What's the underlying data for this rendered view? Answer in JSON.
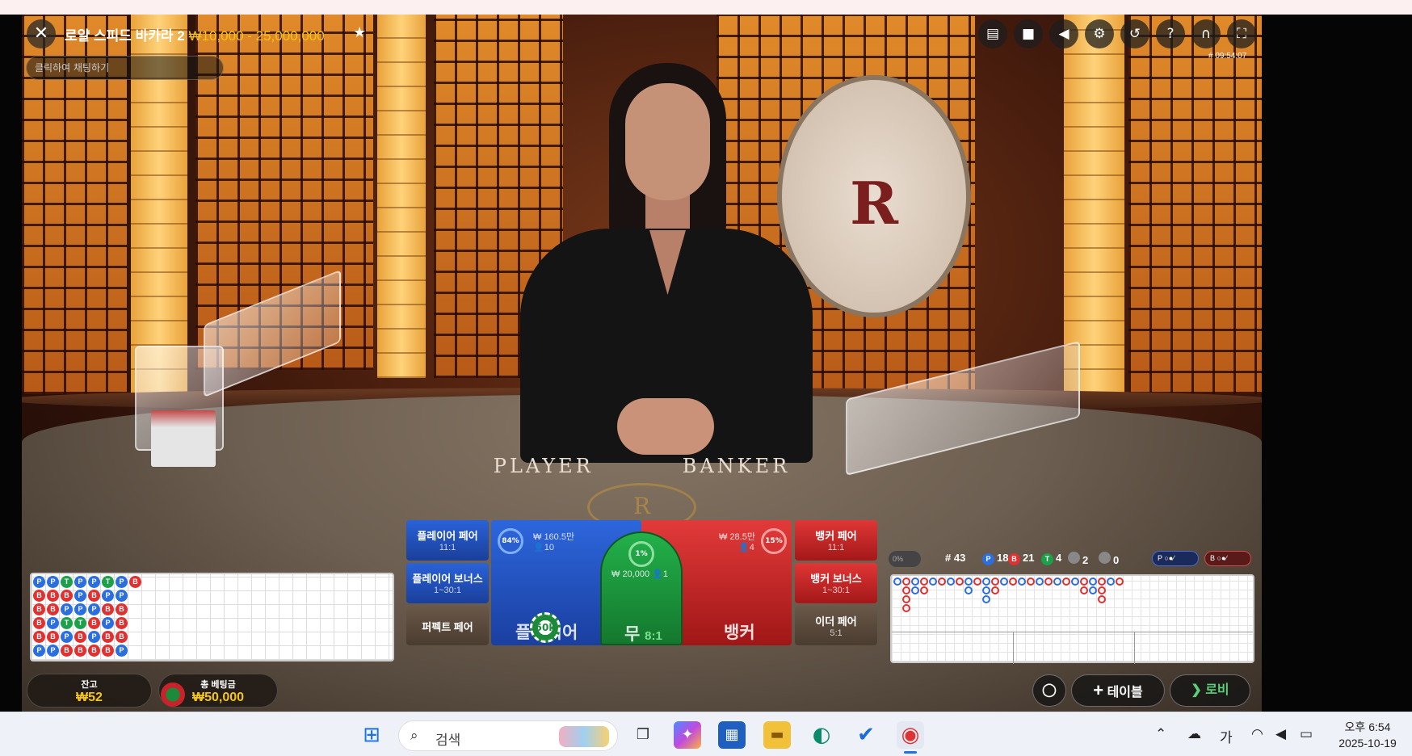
{
  "header": {
    "title": "로얄 스피드 바카라 2",
    "limits": "₩10,000 - 25,000,000",
    "round_time": "# 09:54:07"
  },
  "chat": {
    "placeholder": "클릭하여 채팅하기"
  },
  "icons": {
    "close": "close-icon",
    "favorite": "star-icon",
    "chat": "chat-icon",
    "video": "video-icon",
    "sound": "speaker-icon",
    "settings": "gear-icon",
    "history": "history-icon",
    "help": "help-icon",
    "headset": "headset-icon",
    "fullscreen": "fullscreen-icon"
  },
  "table_printing": {
    "player": "PLAYER",
    "banker": "BANKER",
    "logo": "R"
  },
  "bets": {
    "player_pair": {
      "label": "플레이어 페어",
      "odds": "11:1"
    },
    "player_bonus": {
      "label": "플레이어 보너스",
      "odds": "1~30:1"
    },
    "perfect_pair": {
      "label": "퍼펙트 페어"
    },
    "banker_pair": {
      "label": "뱅커 페어",
      "odds": "11:1"
    },
    "banker_bonus": {
      "label": "뱅커 보너스",
      "odds": "1~30:1"
    },
    "either_pair": {
      "label": "이더 페어",
      "odds": "5:1"
    },
    "player": {
      "label": "플레이어",
      "pct": "84%",
      "amount": "₩ 160.5만",
      "players": "10"
    },
    "tie": {
      "label": "무",
      "odds": "8:1",
      "pct": "1%",
      "amount": "₩ 20,000",
      "players": "1"
    },
    "banker": {
      "label": "뱅커",
      "pct": "15%",
      "amount": "₩ 28.5만",
      "players": "4"
    }
  },
  "chip": {
    "value": "50k"
  },
  "bead_road": [
    [
      "P",
      "B",
      "B",
      "B",
      "B",
      "P"
    ],
    [
      "P",
      "B",
      "B",
      "P",
      "B",
      "P"
    ],
    [
      "T",
      "B",
      "P",
      "T",
      "P",
      "B"
    ],
    [
      "P",
      "P",
      "P",
      "T",
      "B",
      "B"
    ],
    [
      "P",
      "B",
      "P",
      "B",
      "P",
      "B"
    ],
    [
      "T",
      "P",
      "B",
      "P",
      "B",
      "B"
    ],
    [
      "P",
      "P",
      "B",
      "B",
      "B",
      "P"
    ],
    [
      "B",
      "",
      "",
      "",
      "",
      ""
    ]
  ],
  "stats": {
    "pct": "0%",
    "round": "# 43",
    "player": "18",
    "banker": "21",
    "tie": "4",
    "player_pair": "2",
    "banker_pair": "0",
    "p_letter": "P",
    "b_letter": "B",
    "t_letter": "T"
  },
  "balance": {
    "label": "잔고",
    "value": "₩52"
  },
  "total_bet": {
    "label": "총 베팅금",
    "value": "₩50,000"
  },
  "buttons": {
    "table": "테이블",
    "lobby": "로비"
  },
  "taskbar": {
    "search_placeholder": "검색",
    "search_icon": "search-icon",
    "start_icon": "windows-icon",
    "ime": "가",
    "time": "오후 6:54",
    "date": "2025-10-19"
  },
  "colors": {
    "player": "#2a6ee0",
    "banker": "#e03030",
    "tie": "#1ca04a",
    "limits": "#f5c518"
  }
}
